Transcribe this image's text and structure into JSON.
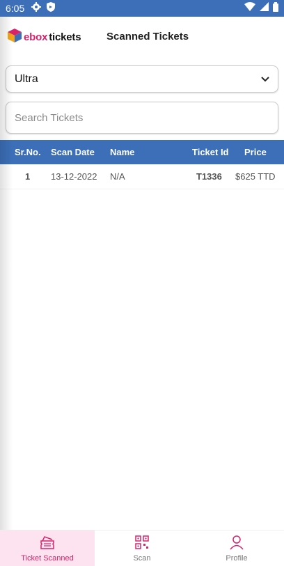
{
  "status_bar": {
    "time": "6:05"
  },
  "header": {
    "logo_part_a": "ebox",
    "logo_part_b": "tickets",
    "title": "Scanned Tickets"
  },
  "filter": {
    "selected_event": "Ultra"
  },
  "search": {
    "placeholder": "Search Tickets"
  },
  "table": {
    "columns": [
      "Sr.No.",
      "Scan Date",
      "Name",
      "Ticket Id",
      "Price"
    ],
    "rows": [
      {
        "sr_no": "1",
        "scan_date": "13-12-2022",
        "name": "N/A",
        "ticket_id": "T1336",
        "price": "$625 TTD"
      }
    ]
  },
  "bottom_nav": {
    "items": [
      {
        "label": "Ticket Scanned",
        "icon": "ticket-icon",
        "active": true
      },
      {
        "label": "Scan",
        "icon": "qr-code-icon",
        "active": false
      },
      {
        "label": "Profile",
        "icon": "person-icon",
        "active": false
      }
    ]
  },
  "colors": {
    "primary": "#3c6fb8",
    "accent": "#d8236b",
    "active_nav_bg": "#fde3ef"
  }
}
